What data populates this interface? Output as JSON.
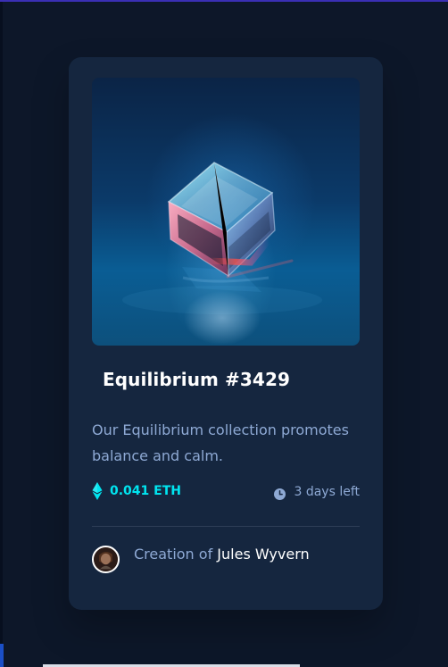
{
  "card": {
    "title": "Equilibrium #3429",
    "description": "Our Equilibrium collection promotes balance and calm.",
    "price": "0.041 ETH",
    "time_left": "3 days left",
    "creator_prefix": "Creation of",
    "creator_name": "Jules Wyvern"
  },
  "icons": {
    "eth": "ethereum-icon",
    "clock": "clock-icon",
    "avatar": "avatar"
  },
  "colors": {
    "page_background": "#0d1729",
    "card_background": "#15263f",
    "accent_cyan": "#00e5f0",
    "muted_blue": "#8ea9d4",
    "white": "#ffffff"
  }
}
